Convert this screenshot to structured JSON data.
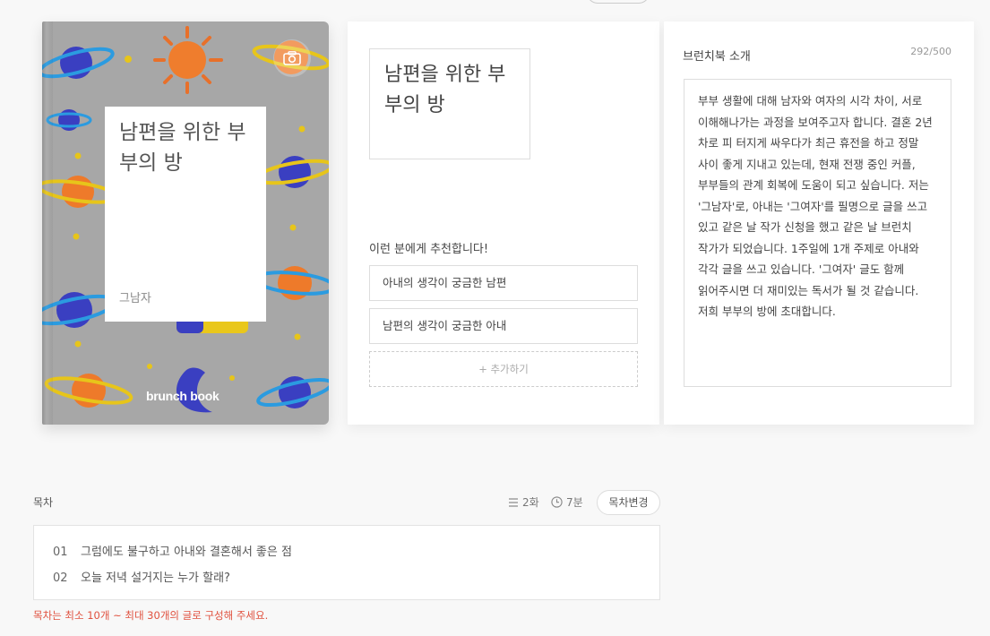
{
  "cover": {
    "title": "남편을 위한 부부의 방",
    "author": "그남자",
    "logo": "brunch book",
    "camera_icon": "camera-icon",
    "bg_color": "#a7a7a7"
  },
  "middle": {
    "title": "남편을 위한 부부의 방",
    "recommend_label": "이런 분에게 추천합니다!",
    "recommend_items": [
      "아내의 생각이 궁금한 남편",
      "남편의 생각이 궁금한 아내"
    ],
    "add_label": "+ 추가하기"
  },
  "intro": {
    "label": "브런치북 소개",
    "count": "292/500",
    "text": "부부 생활에 대해 남자와 여자의 시각 차이, 서로 이해해나가는 과정을 보여주고자 합니다. 결혼 2년 차로 피 터지게 싸우다가 최근 휴전을 하고 정말 사이 좋게 지내고 있는데, 현재 전쟁 중인 커플, 부부들의 관계 회복에 도움이 되고 싶습니다. 저는 '그남자'로, 아내는 '그여자'를 필명으로 글을 쓰고 있고 같은 날 작가 신청을 했고 같은 날 브런치 작가가 되었습니다. 1주일에 1개 주제로 아내와 각각 글을 쓰고 있습니다. '그여자' 글도 함께 읽어주시면 더 재미있는 독서가 될 것 같습니다. 저희 부부의 방에 초대합니다."
  },
  "toc": {
    "label": "목차",
    "episodes": "2화",
    "minutes": "7분",
    "change_button": "목차변경",
    "items": [
      {
        "num": "01",
        "title": "그럼에도 불구하고 아내와 결혼해서 좋은 점"
      },
      {
        "num": "02",
        "title": "오늘 저녁 설거지는 누가 할래?"
      }
    ],
    "warning": "목차는 최소 10개 ~ 최대 30개의 글로 구성해 주세요.",
    "warning_color": "#e0513f"
  }
}
